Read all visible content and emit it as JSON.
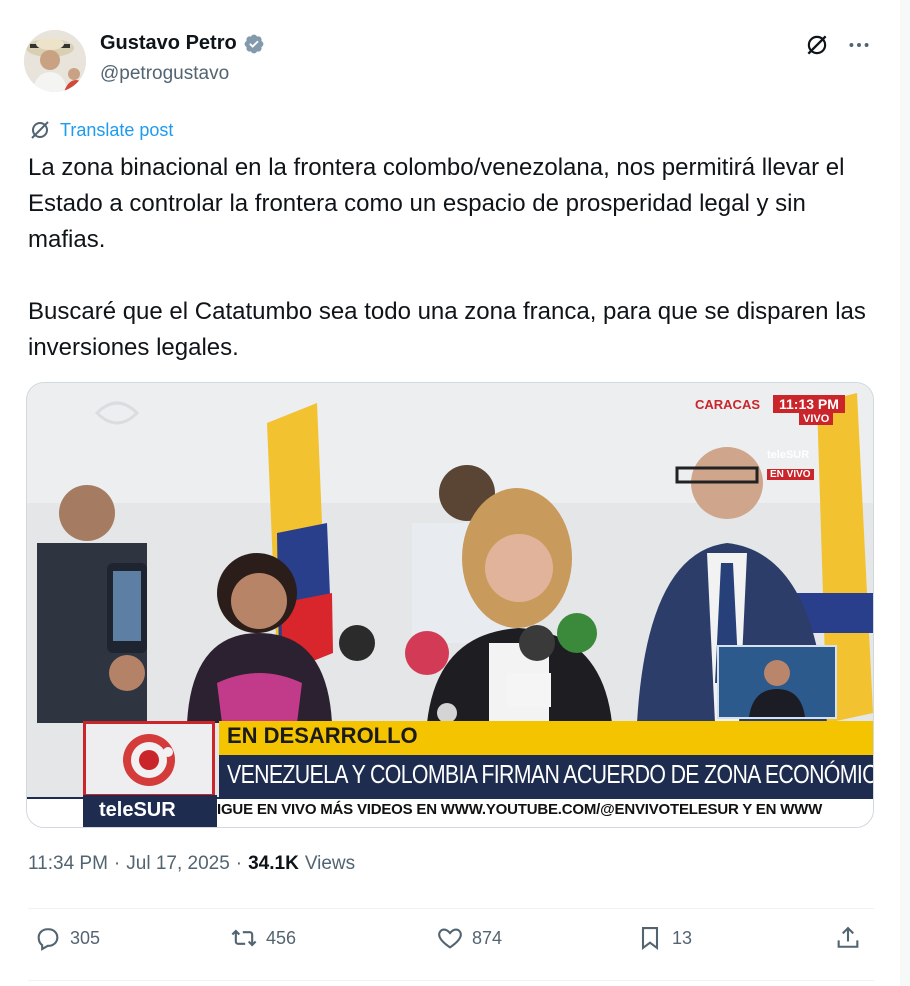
{
  "author": {
    "name": "Gustavo Petro",
    "handle": "@petrogustavo"
  },
  "translate_label": "Translate post",
  "post_text": "La zona binacional en la frontera colombo/venezolana, nos permitirá llevar el Estado a controlar la frontera como un espacio de prosperidad legal y sin mafias.\n\nBuscaré que el Catatumbo sea todo una zona franca, para que se disparen las inversiones legales.",
  "media": {
    "city": "CARACAS",
    "time": "11:13 PM",
    "vivo": "VIVO",
    "bug_channel": "teleSUR",
    "bug_envivo": "EN VIVO",
    "headline_top": "EN DESARROLLO",
    "headline_main": "VENEZUELA Y COLOMBIA FIRMAN ACUERDO DE ZONA ECONÓMICA",
    "channel": "teleSUR",
    "ticker": "IGUE EN VIVO MÁS VIDEOS EN WWW.YOUTUBE.COM/@ENVIVOTELESUR Y EN WWW"
  },
  "meta": {
    "time": "11:34 PM",
    "separator": "·",
    "date": "Jul 17, 2025",
    "views_count": "34.1K",
    "views_label": "Views"
  },
  "actions": {
    "replies": "305",
    "reposts": "456",
    "likes": "874",
    "bookmarks": "13"
  },
  "colors": {
    "link_blue": "#1d9bf0",
    "verified_gray": "#829aab",
    "secondary_text": "#536471",
    "primary_text": "#0f1419",
    "telesur_navy": "#1e2d4f",
    "telesur_red": "#c9252b",
    "headline_yellow": "#f5c400"
  },
  "icons": [
    "verified-badge-icon",
    "grok-icon",
    "more-icon",
    "translate-icon",
    "reply-icon",
    "repost-icon",
    "like-icon",
    "bookmark-icon",
    "share-icon"
  ]
}
